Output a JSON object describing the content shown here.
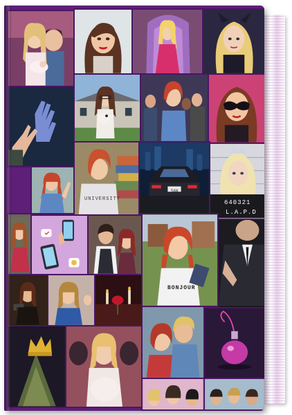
{
  "cover": {
    "tiles": [
      {
        "name": "tile-new-parents",
        "icon": "couple-with-baby-icon"
      },
      {
        "name": "tile-woman-red-lips",
        "icon": "woman-portrait-icon"
      },
      {
        "name": "tile-throne-woman",
        "icon": "throne-icon"
      },
      {
        "name": "tile-blonde-horns",
        "icon": "blonde-woman-icon"
      },
      {
        "name": "tile-reaching-hands",
        "icon": "hands-icon"
      },
      {
        "name": "tile-mansion-dog",
        "icon": "mansion-icon"
      },
      {
        "name": "tile-group-friends",
        "icon": "group-icon"
      },
      {
        "name": "tile-masked-woman",
        "icon": "mask-icon"
      },
      {
        "name": "tile-waving-redhead",
        "icon": "woman-waving-icon"
      },
      {
        "name": "tile-university-student",
        "icon": "books-icon"
      },
      {
        "name": "tile-car-night",
        "icon": "car-icon"
      },
      {
        "name": "tile-mugshot",
        "icon": "mugshot-icon"
      },
      {
        "name": "tile-phones-chat",
        "icon": "phone-icon"
      },
      {
        "name": "tile-couple-phone",
        "icon": "couple-icon"
      },
      {
        "name": "tile-bonjour-girl",
        "icon": "book-icon"
      },
      {
        "name": "tile-man-suit",
        "icon": "suit-icon"
      },
      {
        "name": "tile-woman-gun",
        "icon": "pistol-icon"
      },
      {
        "name": "tile-blue-dress",
        "icon": "woman-portrait-icon"
      },
      {
        "name": "tile-rose-candle",
        "icon": "rose-icon"
      },
      {
        "name": "tile-crown-money",
        "icon": "crown-icon"
      },
      {
        "name": "tile-pregnant-woman",
        "icon": "pregnant-icon"
      },
      {
        "name": "tile-blond-couple",
        "icon": "couple-icon"
      },
      {
        "name": "tile-potion",
        "icon": "potion-icon"
      },
      {
        "name": "tile-group-bottom",
        "icon": "group-icon"
      },
      {
        "name": "tile-men-bottom",
        "icon": "group-icon"
      }
    ],
    "texts": {
      "university": "UNIVERSITY",
      "mugshot_number": "640321",
      "mugshot_lapd": "L.A.P.D",
      "bonjour": "BONJOUR",
      "plate": "56K"
    },
    "colors": {
      "frame": "#5e1f78",
      "border": "#4a1663",
      "pages": "#ecd7ee"
    }
  }
}
